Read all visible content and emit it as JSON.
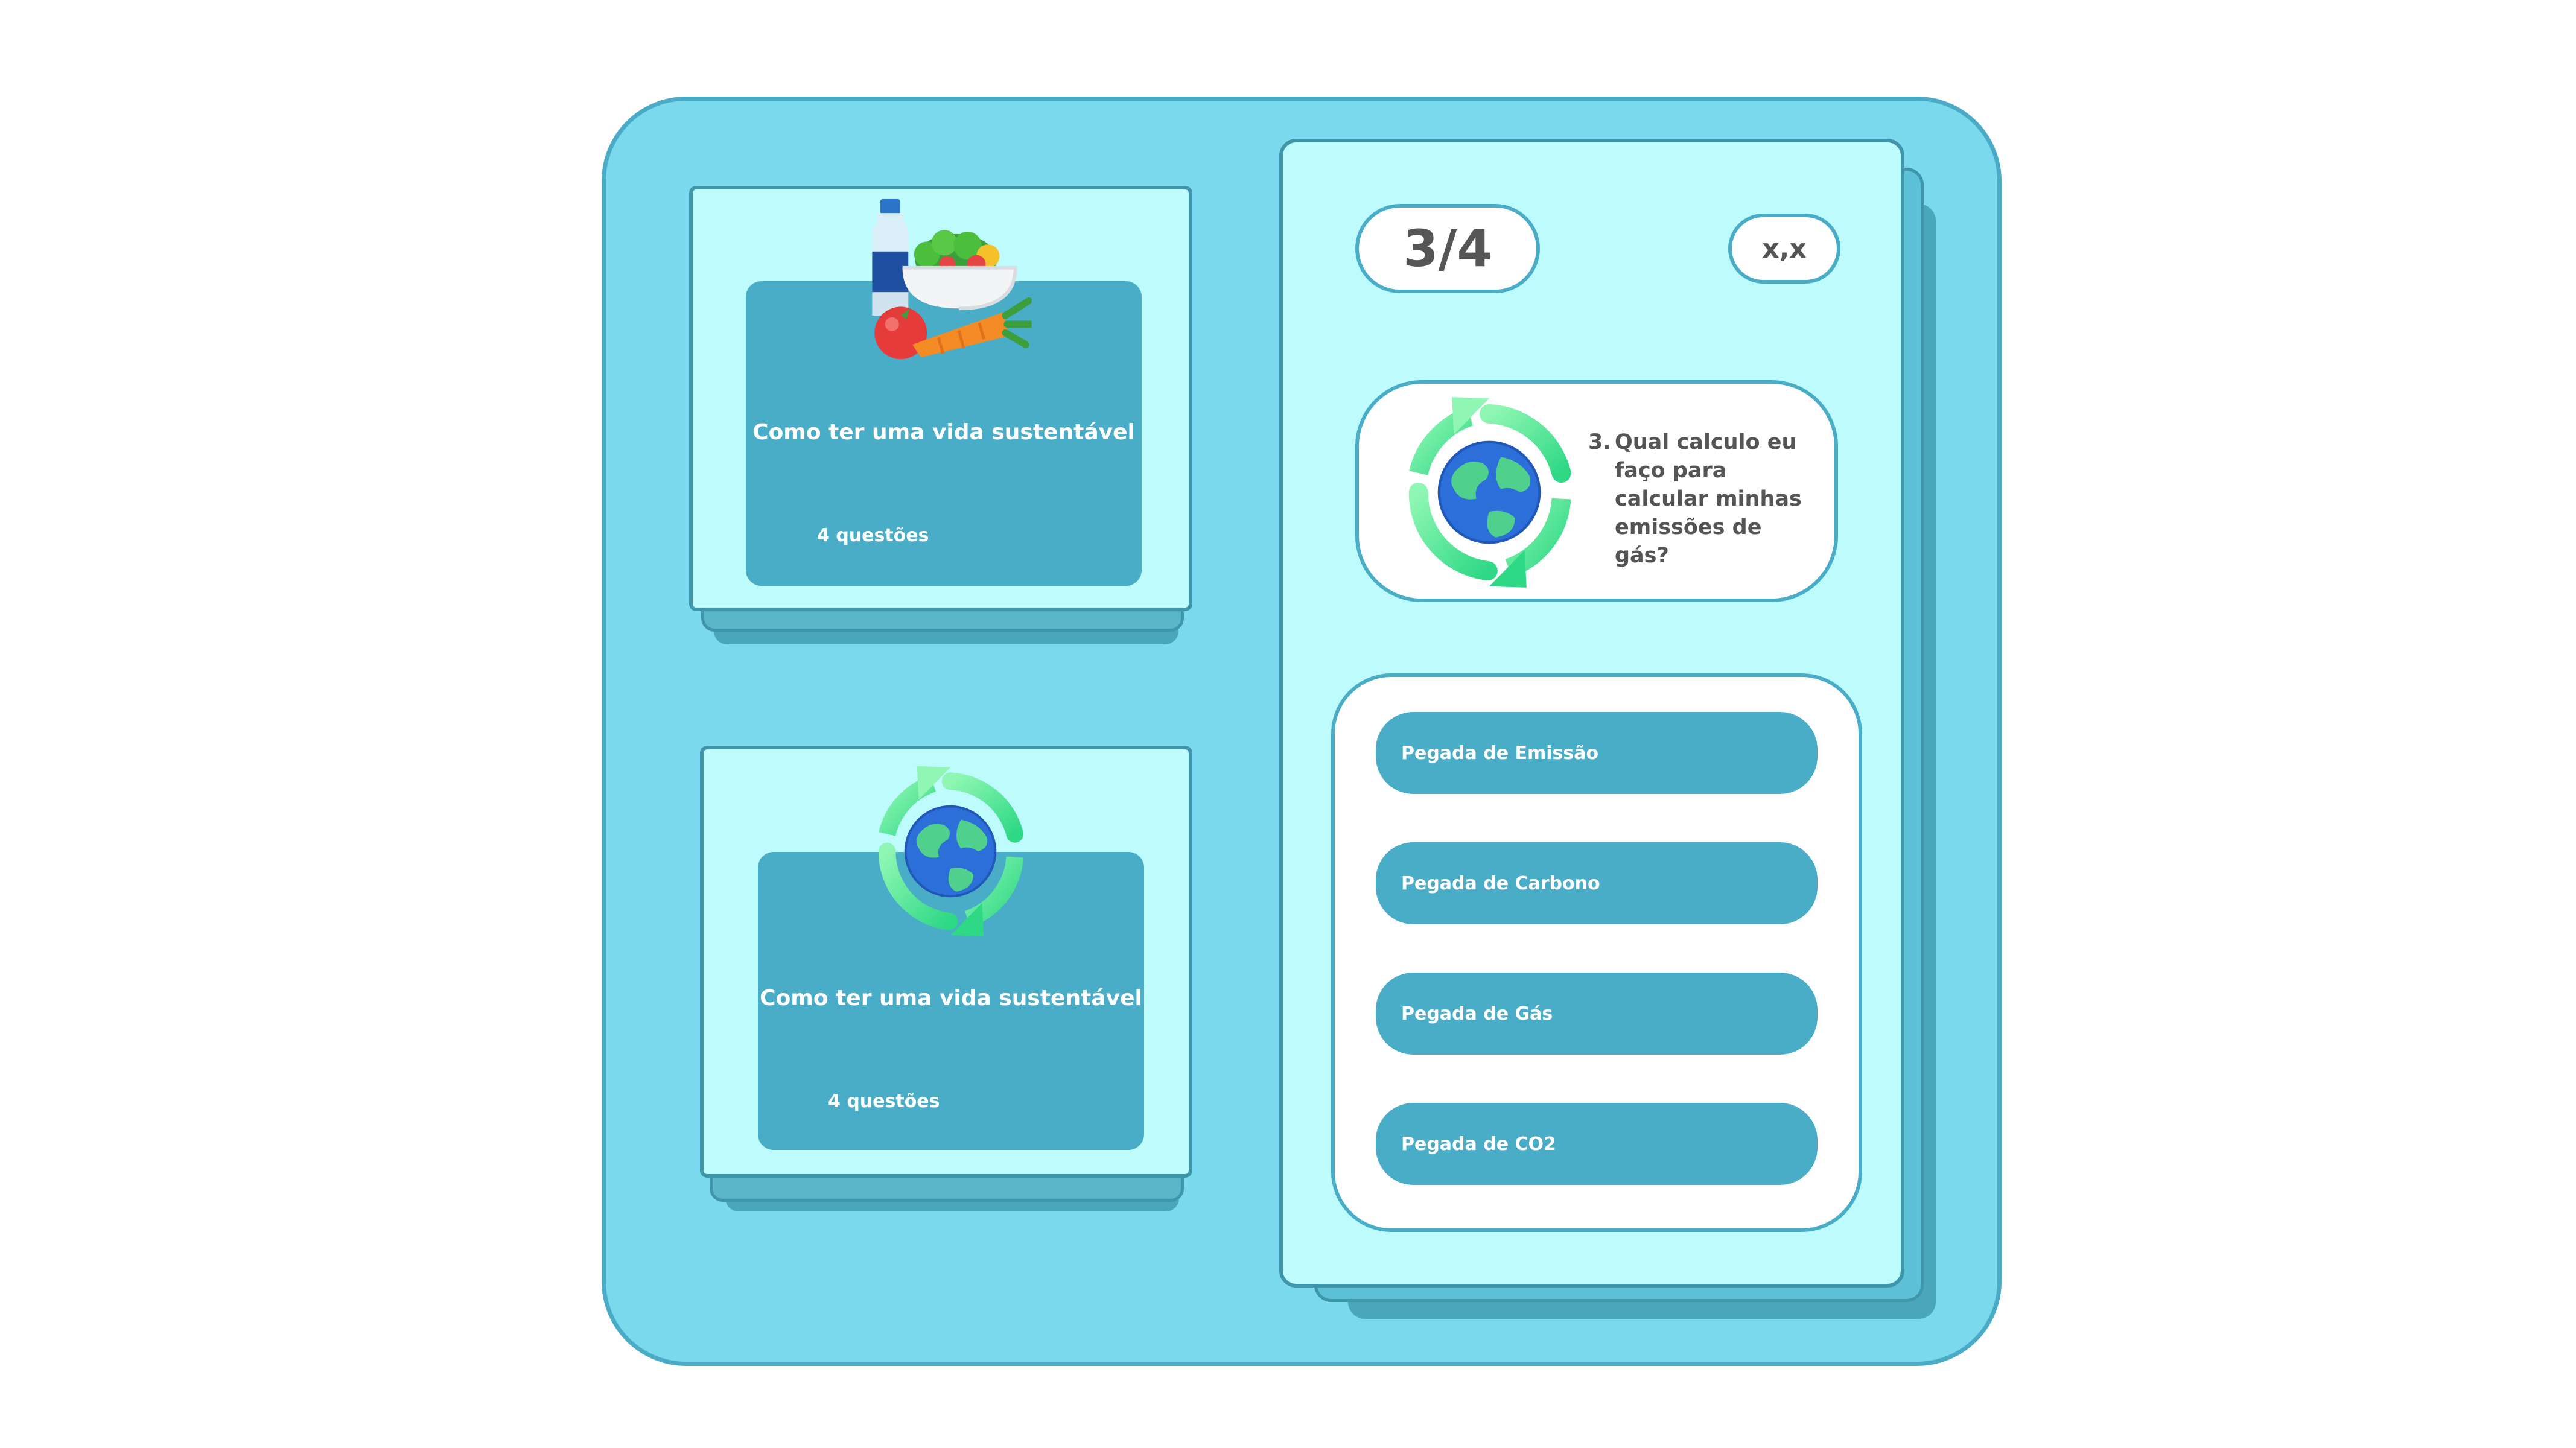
{
  "cards": [
    {
      "title": "Como ter uma vida sustentável",
      "count": "4 questões",
      "icon": "healthy-food-icon"
    },
    {
      "title": "Como ter uma vida sustentável",
      "count": "4 questões",
      "icon": "recycle-earth-icon"
    }
  ],
  "quiz": {
    "progress": "3/4",
    "score": "x,x",
    "question_number": "3.",
    "question": "Qual calculo eu faço para calcular minhas emissões de gás?",
    "question_icon": "recycle-earth-icon",
    "answers": [
      "Pegada de Emissão",
      "Pegada de Carbono",
      "Pegada de Gás",
      "Pegada de CO2"
    ]
  },
  "colors": {
    "frame": "#7bd9ed",
    "card_bg": "#bdfbfd",
    "accent": "#49adc7",
    "border": "#3f95aa"
  }
}
